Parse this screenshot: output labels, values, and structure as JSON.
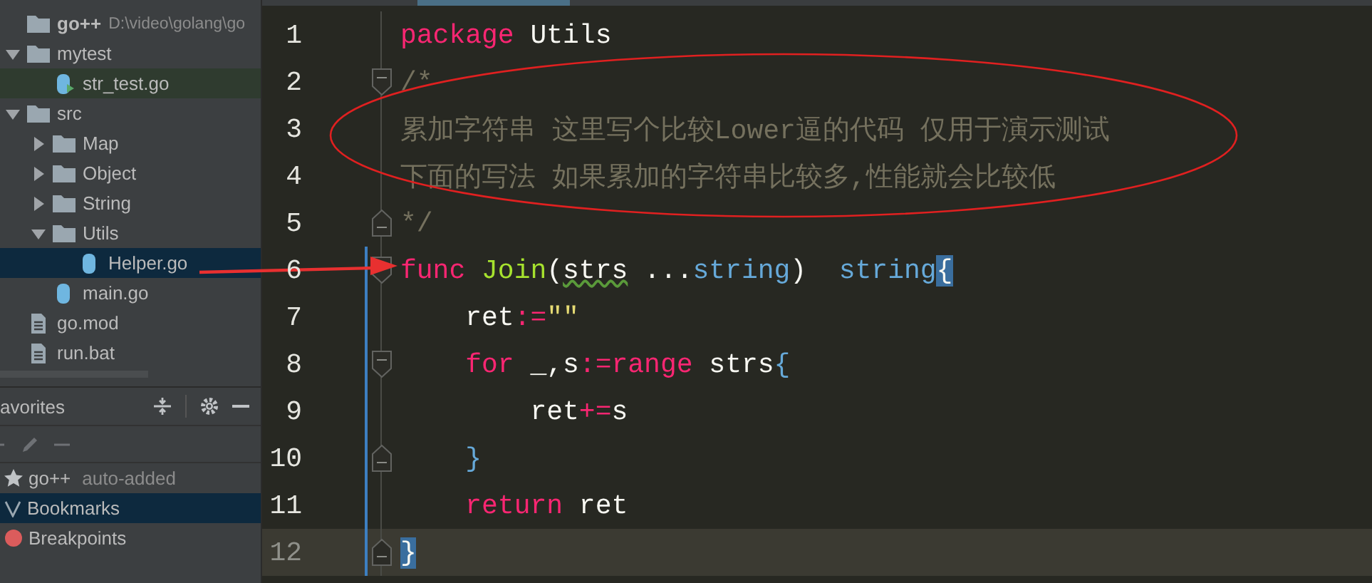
{
  "project_tree": {
    "root": {
      "name": "go++",
      "path": "D:\\video\\golang\\go"
    },
    "items": [
      {
        "name": "mytest",
        "kind": "folder",
        "expanded": true,
        "selected": false,
        "highlighted": false,
        "children": [
          {
            "name": "str_test.go",
            "kind": "gotest",
            "selected": false,
            "highlighted": true
          }
        ]
      },
      {
        "name": "src",
        "kind": "folder",
        "expanded": true,
        "selected": false,
        "highlighted": false,
        "children": [
          {
            "name": "Map",
            "kind": "folder",
            "expanded": false,
            "selected": false,
            "highlighted": false
          },
          {
            "name": "Object",
            "kind": "folder",
            "expanded": false,
            "selected": false,
            "highlighted": false
          },
          {
            "name": "String",
            "kind": "folder",
            "expanded": false,
            "selected": false,
            "highlighted": false
          },
          {
            "name": "Utils",
            "kind": "folder",
            "expanded": true,
            "selected": false,
            "highlighted": false,
            "children": [
              {
                "name": "Helper.go",
                "kind": "gofile",
                "selected": true,
                "highlighted": false
              }
            ]
          },
          {
            "name": "main.go",
            "kind": "gofile",
            "selected": false,
            "highlighted": false
          }
        ]
      },
      {
        "name": "go.mod",
        "kind": "doc",
        "selected": false,
        "highlighted": false
      },
      {
        "name": "run.bat",
        "kind": "doc",
        "selected": false,
        "highlighted": false
      }
    ]
  },
  "favorites": {
    "title": "avorites",
    "items": [
      {
        "kind": "star",
        "label": "go++",
        "note": "auto-added",
        "selected": false
      },
      {
        "kind": "bookmark",
        "label": "Bookmarks",
        "selected": true
      },
      {
        "kind": "breakpoint",
        "label": "Breakpoints",
        "selected": false
      }
    ]
  },
  "editor": {
    "lines": [
      {
        "number": "1",
        "fold_start": false,
        "fold_end": false,
        "current": false,
        "changed": false,
        "tokens": [
          {
            "kind": "kw",
            "text": "package"
          },
          {
            "kind": "plain",
            "text": " Utils"
          }
        ]
      },
      {
        "number": "2",
        "fold_start": true,
        "fold_end": false,
        "current": false,
        "changed": false,
        "tokens": [
          {
            "kind": "comment",
            "text": "/*"
          }
        ]
      },
      {
        "number": "3",
        "fold_start": false,
        "fold_end": false,
        "current": false,
        "changed": false,
        "tokens": [
          {
            "kind": "comment",
            "text": "累加字符串 这里写个比较Lower逼的代码 仅用于演示测试"
          }
        ]
      },
      {
        "number": "4",
        "fold_start": false,
        "fold_end": false,
        "current": false,
        "changed": false,
        "tokens": [
          {
            "kind": "comment",
            "text": "下面的写法 如果累加的字符串比较多,性能就会比较低"
          }
        ]
      },
      {
        "number": "5",
        "fold_start": false,
        "fold_end": true,
        "current": false,
        "changed": false,
        "tokens": [
          {
            "kind": "comment",
            "text": "*/"
          }
        ]
      },
      {
        "number": "6",
        "fold_start": true,
        "fold_end": false,
        "current": false,
        "changed": true,
        "tokens": [
          {
            "kind": "kw",
            "text": "func"
          },
          {
            "kind": "fn",
            "text": " Join"
          },
          {
            "kind": "plain",
            "text": "("
          },
          {
            "kind": "warn",
            "text": "strs"
          },
          {
            "kind": "plain",
            "text": " ..."
          },
          {
            "kind": "type",
            "text": "string"
          },
          {
            "kind": "plain",
            "text": ")"
          },
          {
            "kind": "type",
            "text": "  string"
          },
          {
            "kind": "match",
            "text": "{"
          }
        ]
      },
      {
        "number": "7",
        "fold_start": false,
        "fold_end": false,
        "current": false,
        "changed": true,
        "tokens": [
          {
            "kind": "plain",
            "text": "    ret"
          },
          {
            "kind": "op",
            "text": ":="
          },
          {
            "kind": "str",
            "text": "\"\""
          }
        ]
      },
      {
        "number": "8",
        "fold_start": true,
        "fold_end": false,
        "current": false,
        "changed": true,
        "tokens": [
          {
            "kind": "kw",
            "text": "    for"
          },
          {
            "kind": "plain",
            "text": " _,s"
          },
          {
            "kind": "op",
            "text": ":="
          },
          {
            "kind": "kw",
            "text": "range"
          },
          {
            "kind": "plain",
            "text": " strs"
          },
          {
            "kind": "type",
            "text": "{"
          }
        ]
      },
      {
        "number": "9",
        "fold_start": false,
        "fold_end": false,
        "current": false,
        "changed": true,
        "tokens": [
          {
            "kind": "plain",
            "text": "        ret"
          },
          {
            "kind": "op",
            "text": "+="
          },
          {
            "kind": "plain",
            "text": "s"
          }
        ]
      },
      {
        "number": "10",
        "fold_start": false,
        "fold_end": true,
        "current": false,
        "changed": true,
        "tokens": [
          {
            "kind": "type",
            "text": "    }"
          }
        ]
      },
      {
        "number": "11",
        "fold_start": false,
        "fold_end": false,
        "current": false,
        "changed": true,
        "tokens": [
          {
            "kind": "kw",
            "text": "    return"
          },
          {
            "kind": "plain",
            "text": " ret"
          }
        ]
      },
      {
        "number": "12",
        "fold_start": false,
        "fold_end": true,
        "current": true,
        "changed": true,
        "tokens": [
          {
            "kind": "match",
            "text": "}"
          }
        ]
      }
    ]
  }
}
